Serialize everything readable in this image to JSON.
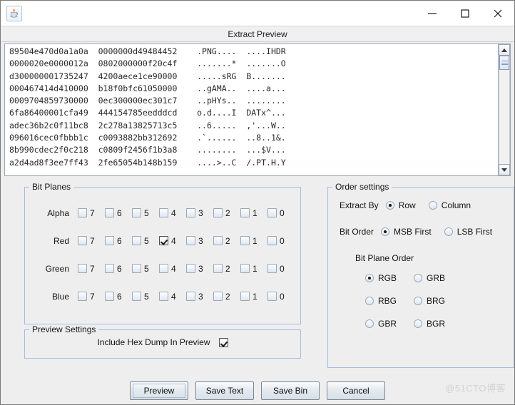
{
  "window": {
    "app_icon": "java-coffee-cup-icon",
    "minimize_label": "–",
    "maximize_label": "□",
    "close_label": "✕",
    "subtitle": "Extract Preview"
  },
  "hexdump": {
    "lines": [
      {
        "hex1": "89504e470d0a1a0a",
        "hex2": "0000000d49484452",
        "ascii": ".PNG....  ....IHDR"
      },
      {
        "hex1": "0000020e0000012a",
        "hex2": "0802000000f20c4f",
        "ascii": ".......*  .......O"
      },
      {
        "hex1": "d300000001735247",
        "hex2": "4200aece1ce90000",
        "ascii": ".....sRG  B......."
      },
      {
        "hex1": "000467414d410000",
        "hex2": "b18f0bfc61050000",
        "ascii": "..gAMA..  ....a..."
      },
      {
        "hex1": "0009704859730000",
        "hex2": "0ec300000ec301c7",
        "ascii": "..pHYs..  ........"
      },
      {
        "hex1": "6fa86400001cfa49",
        "hex2": "444154785eedddcd",
        "ascii": "o.d....I  DATx^..."
      },
      {
        "hex1": "adec36b2c0f11bc8",
        "hex2": "2c278a13825713c5",
        "ascii": "..6.....  ,'...W.."
      },
      {
        "hex1": "096016cec0fbbb1c",
        "hex2": "c0093882bb312692",
        "ascii": ".`......  ..8..1&."
      },
      {
        "hex1": "8b990cdec2f0c218",
        "hex2": "c0809f2456f1b3a8",
        "ascii": "........  ...$V..."
      },
      {
        "hex1": "a2d4ad8f3ee7ff43",
        "hex2": "2fe65054b148b159",
        "ascii": "....>..C  /.PT.H.Y"
      }
    ]
  },
  "bit_planes": {
    "legend": "Bit Planes",
    "bit_labels": [
      "7",
      "6",
      "5",
      "4",
      "3",
      "2",
      "1",
      "0"
    ],
    "channels": [
      {
        "label": "Alpha",
        "checked": [
          false,
          false,
          false,
          false,
          false,
          false,
          false,
          false
        ]
      },
      {
        "label": "Red",
        "checked": [
          false,
          false,
          false,
          true,
          false,
          false,
          false,
          false
        ]
      },
      {
        "label": "Green",
        "checked": [
          false,
          false,
          false,
          false,
          false,
          false,
          false,
          false
        ]
      },
      {
        "label": "Blue",
        "checked": [
          false,
          false,
          false,
          false,
          false,
          false,
          false,
          false
        ]
      }
    ]
  },
  "preview_settings": {
    "legend": "Preview Settings",
    "include_hex_dump_label": "Include Hex Dump In Preview",
    "include_hex_dump_checked": true
  },
  "order_settings": {
    "legend": "Order settings",
    "extract_by_label": "Extract By",
    "extract_by_options": [
      "Row",
      "Column"
    ],
    "extract_by_selected": "Row",
    "bit_order_label": "Bit Order",
    "bit_order_options": [
      "MSB First",
      "LSB First"
    ],
    "bit_order_selected": "MSB First",
    "bit_plane_order_label": "Bit Plane Order",
    "bit_plane_order_options": [
      "RGB",
      "GRB",
      "RBG",
      "BRG",
      "GBR",
      "BGR"
    ],
    "bit_plane_order_selected": "RGB"
  },
  "buttons": [
    {
      "label": "Preview",
      "focused": true
    },
    {
      "label": "Save Text",
      "focused": false
    },
    {
      "label": "Save Bin",
      "focused": false
    },
    {
      "label": "Cancel",
      "focused": false
    }
  ],
  "watermark": "@51CTO博客"
}
